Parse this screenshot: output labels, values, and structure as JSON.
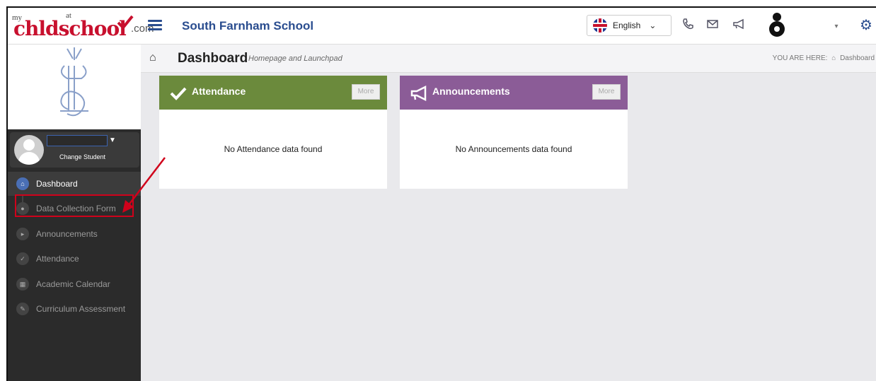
{
  "app": {
    "logo_my": "my",
    "logo_at": "at",
    "logo_word": "chldschool",
    "logo_com": ".com",
    "school_name": "South Farnham School"
  },
  "header": {
    "language": "English",
    "icons": [
      "phone-icon",
      "mail-icon",
      "megaphone-icon",
      "avatar-icon",
      "gear-icon"
    ]
  },
  "student": {
    "change_label": "Change Student"
  },
  "sidebar": {
    "items": [
      {
        "label": "Dashboard",
        "icon": "home-icon",
        "active": true
      },
      {
        "label": "Data Collection Form",
        "icon": "user-icon",
        "active": false
      },
      {
        "label": "Announcements",
        "icon": "megaphone-icon",
        "active": false
      },
      {
        "label": "Attendance",
        "icon": "check-icon",
        "active": false
      },
      {
        "label": "Academic Calendar",
        "icon": "calendar-icon",
        "active": false
      },
      {
        "label": "Curriculum Assessment",
        "icon": "pencil-icon",
        "active": false
      }
    ]
  },
  "page": {
    "title": "Dashboard",
    "subtitle": "Homepage and Launchpad",
    "here_label": "YOU ARE HERE:",
    "here_crumb": "Dashboard"
  },
  "widgets": {
    "attendance": {
      "title": "Attendance",
      "more": "More",
      "empty": "No Attendance data found",
      "color": "#6b8a3c"
    },
    "announcements": {
      "title": "Announcements",
      "more": "More",
      "empty": "No Announcements data found",
      "color": "#8b5c97"
    }
  },
  "colors": {
    "accent": "#2a4d8f",
    "highlight": "#d0021b"
  }
}
